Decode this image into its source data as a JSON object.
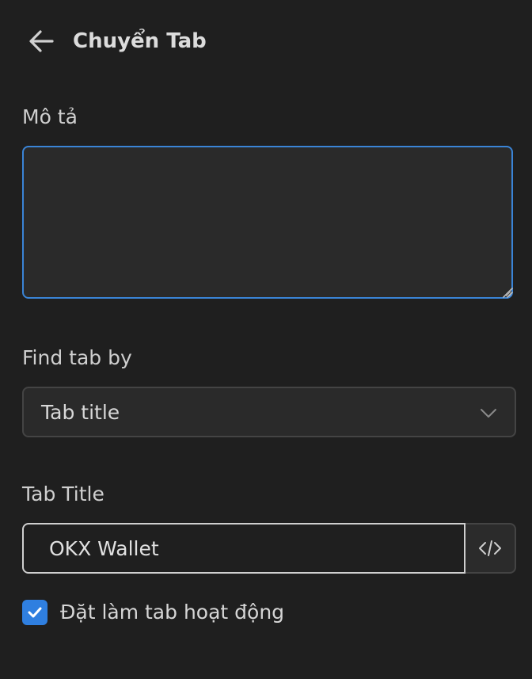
{
  "header": {
    "title": "Chuyển Tab",
    "back_icon": "arrow-left-icon"
  },
  "description": {
    "label": "Mô tả",
    "value": ""
  },
  "find_tab_by": {
    "label": "Find tab by",
    "selected": "Tab title",
    "chevron_icon": "chevron-down-icon"
  },
  "tab_title": {
    "label": "Tab Title",
    "value": "OKX Wallet",
    "code_icon": "code-icon"
  },
  "active_tab": {
    "label": "Đặt làm tab hoạt động",
    "checked": true,
    "check_icon": "checkmark-icon"
  },
  "colors": {
    "background": "#1f1f1f",
    "accent": "#2f7fe0",
    "focus_border": "#3a84d6"
  }
}
